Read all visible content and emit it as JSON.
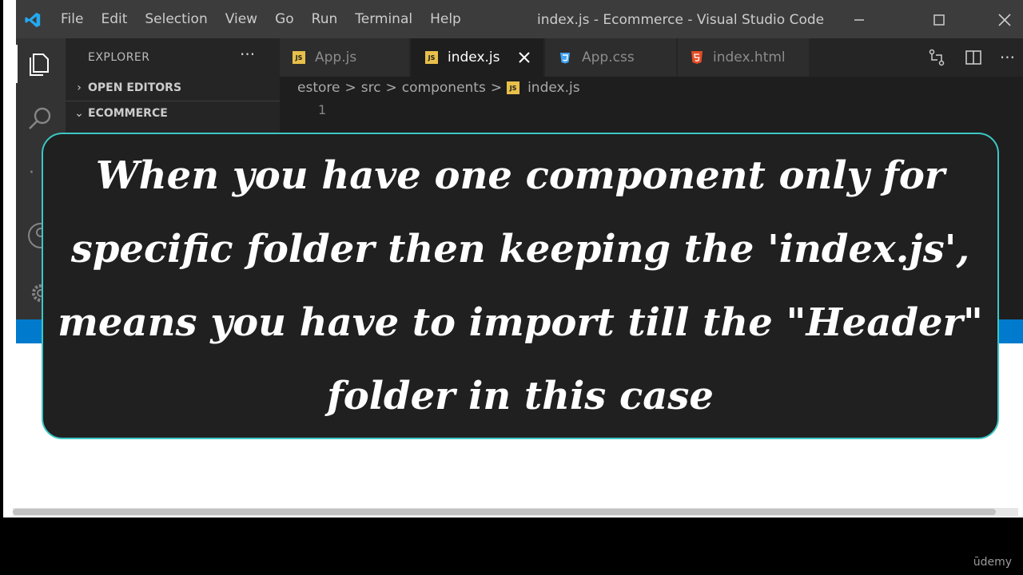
{
  "window": {
    "title": "index.js - Ecommerce - Visual Studio Code",
    "menu": [
      "File",
      "Edit",
      "Selection",
      "View",
      "Go",
      "Run",
      "Terminal",
      "Help"
    ]
  },
  "sidebar": {
    "title": "EXPLORER",
    "more": "···",
    "sections": [
      {
        "label": "OPEN EDITORS",
        "chevron": "›"
      },
      {
        "label": "ECOMMERCE",
        "chevron": "⌄"
      }
    ]
  },
  "tabs": [
    {
      "label": "App.js",
      "icon": "js-file-icon"
    },
    {
      "label": "index.js",
      "icon": "js-file-icon",
      "active": true
    },
    {
      "label": "App.css",
      "icon": "css-file-icon"
    },
    {
      "label": "index.html",
      "icon": "html-file-icon"
    }
  ],
  "js_badge": "JS",
  "breadcrumb": {
    "parts": [
      "estore",
      "src",
      "components",
      "index.js"
    ],
    "separator": ">"
  },
  "editor": {
    "line_number": "1"
  },
  "overlay": {
    "text": "When you have one component only for specific folder then keeping the 'index.js', means you have to import till the \"Header\" folder in this case"
  },
  "watermark": "ūdemy",
  "colors": {
    "titlebar": "#3c3c3c",
    "activitybar": "#333333",
    "sidebar": "#252526",
    "editor": "#1e1e1e",
    "statusbar": "#007acc",
    "overlay_border": "#3cc7c4",
    "overlay_bg": "#202020",
    "js_icon": "#e8c04a",
    "css_icon": "#42a5f5",
    "html_icon": "#e44d26"
  }
}
